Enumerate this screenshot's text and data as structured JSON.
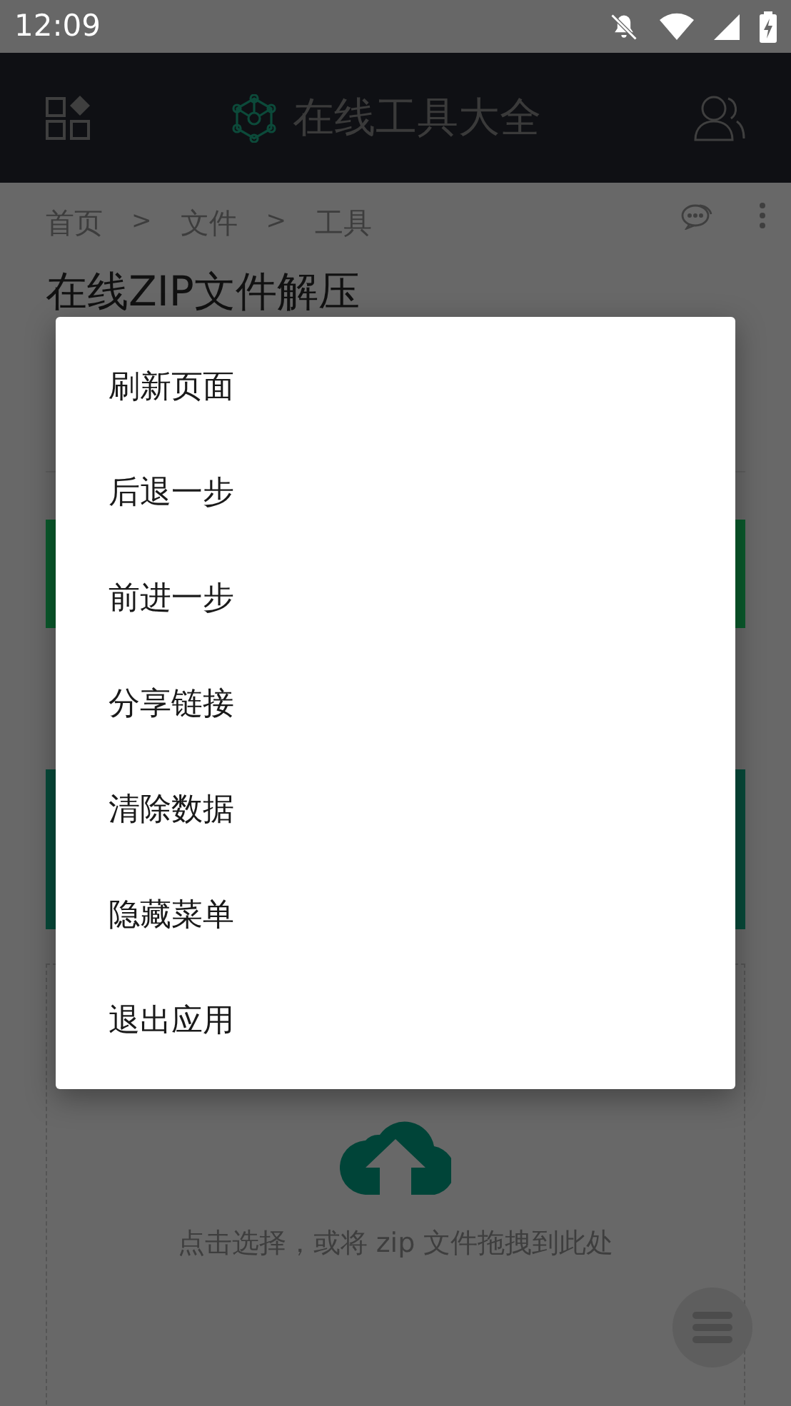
{
  "status_bar": {
    "time": "12:09"
  },
  "header": {
    "title": "在线工具大全"
  },
  "breadcrumb": {
    "items": [
      "首页",
      "文件",
      "工具"
    ],
    "separator": ">"
  },
  "page_title": "在线ZIP文件解压",
  "upload": {
    "hint": "点击选择，或将 zip 文件拖拽到此处"
  },
  "menu": {
    "items": [
      "刷新页面",
      "后退一步",
      "前进一步",
      "分享链接",
      "清除数据",
      "隐藏菜单",
      "退出应用"
    ]
  }
}
